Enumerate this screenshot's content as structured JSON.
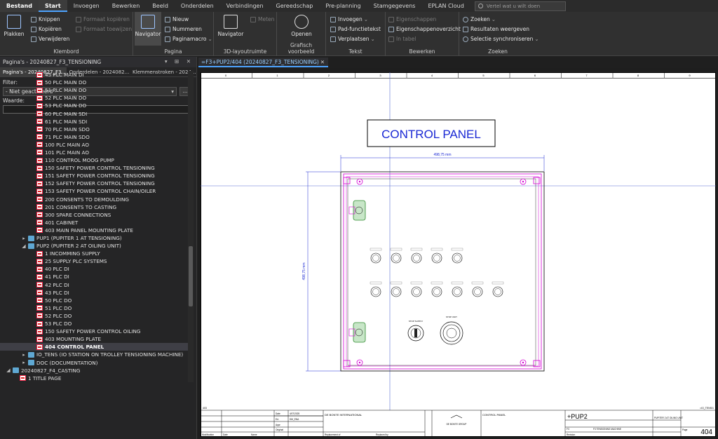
{
  "menubar": {
    "tabs": [
      "Bestand",
      "Start",
      "Invoegen",
      "Bewerken",
      "Beeld",
      "Onderdelen",
      "Verbindingen",
      "Gereedschap",
      "Pre-planning",
      "Stamgegevens",
      "EPLAN Cloud"
    ],
    "tellme_placeholder": "Vertel wat u wilt doen"
  },
  "ribbon": {
    "klembord": {
      "label": "Klembord",
      "paste": "Plakken",
      "cut": "Knippen",
      "copy": "Kopiëren",
      "delete": "Verwijderen",
      "copy_format": "Formaat kopiëren",
      "assign_format": "Formaat toewijzen"
    },
    "pagina": {
      "label": "Pagina",
      "navigator": "Navigator",
      "new": "Nieuw",
      "numbering": "Nummeren",
      "page_macro": "Paginamacro"
    },
    "layout3d": {
      "label": "3D-layoutruimte",
      "navigator": "Navigator",
      "measure": "Meten"
    },
    "graphic_preview": {
      "label": "Grafisch voorbeeld",
      "open": "Openen"
    },
    "tekst": {
      "label": "Tekst",
      "insert": "Invoegen",
      "path_text": "Pad-functietekst",
      "move": "Verplaatsen"
    },
    "bewerken": {
      "label": "Bewerken",
      "properties": "Eigenschappen",
      "properties_overview": "Eigenschappenoverzicht",
      "in_table": "In tabel"
    },
    "zoeken": {
      "label": "Zoeken",
      "search": "Zoeken",
      "show_results": "Resultaten weergeven",
      "sync_selection": "Selectie synchroniseren"
    }
  },
  "leftpanel": {
    "title": "Pagina's - 20240827_F3_TENSIONING",
    "tabs": [
      "Pagina's - 20240827_F3...",
      "Onderdelen - 2024082...",
      "Klemmenstroken - 2024..."
    ],
    "filter_label": "Filter:",
    "filter_value": "- Niet geactiveerd -",
    "value_label": "Waarde:",
    "tree": [
      {
        "text": "45 PLC MAIN DI",
        "type": "page"
      },
      {
        "text": "50 PLC MAIN DO",
        "type": "page"
      },
      {
        "text": "51 PLC MAIN DO",
        "type": "page"
      },
      {
        "text": "52 PLC MAIN DO",
        "type": "page"
      },
      {
        "text": "53 PLC MAIN DO",
        "type": "page"
      },
      {
        "text": "60 PLC MAIN SDI",
        "type": "page"
      },
      {
        "text": "61 PLC MAIN SDI",
        "type": "page"
      },
      {
        "text": "70 PLC MAIN SDO",
        "type": "page"
      },
      {
        "text": "71 PLC MAIN SDO",
        "type": "page"
      },
      {
        "text": "100 PLC MAIN AO",
        "type": "page"
      },
      {
        "text": "101 PLC MAIN AO",
        "type": "page"
      },
      {
        "text": "110 CONTROL MOOG PUMP",
        "type": "page"
      },
      {
        "text": "150 SAFETY POWER CONTROL TENSIONING",
        "type": "page"
      },
      {
        "text": "151 SAFETY POWER CONTROL TENSIONING",
        "type": "page"
      },
      {
        "text": "152 SAFETY POWER CONTROL TENSIONING",
        "type": "page"
      },
      {
        "text": "153 SAFETY POWER CONTROL  CHAIN/OILER",
        "type": "page"
      },
      {
        "text": "200 CONSENTS TO DEMOULDING",
        "type": "page"
      },
      {
        "text": "201 CONSENTS TO CASTING",
        "type": "page"
      },
      {
        "text": "300 SPARE CONNECTIONS",
        "type": "page"
      },
      {
        "text": "401 CABINET",
        "type": "page"
      },
      {
        "text": "403 MAIN PANEL MOUNTING PLATE",
        "type": "page"
      },
      {
        "text": "PUP1 (PUPITER 1 AT TENSIONING)",
        "type": "folder",
        "exp": "+"
      },
      {
        "text": "PUP2 (PUPITER 2 AT OILING UNIT)",
        "type": "folder",
        "exp": "-"
      },
      {
        "text": "1 INCOMMING SUPPLY",
        "type": "page"
      },
      {
        "text": "25 SUPPLY PLC SYSTEMS",
        "type": "page"
      },
      {
        "text": "40 PLC DI",
        "type": "page"
      },
      {
        "text": "41 PLC DI",
        "type": "page"
      },
      {
        "text": "42 PLC DI",
        "type": "page"
      },
      {
        "text": "43 PLC DI",
        "type": "page"
      },
      {
        "text": "50 PLC DO",
        "type": "page"
      },
      {
        "text": "51 PLC DO",
        "type": "page"
      },
      {
        "text": "52 PLC DO",
        "type": "page"
      },
      {
        "text": "53 PLC DO",
        "type": "page"
      },
      {
        "text": "150 SAFETY POWER CONTROL OILING",
        "type": "page"
      },
      {
        "text": "403 MOUNTING PLATE",
        "type": "page"
      },
      {
        "text": "404 CONTROL PANEL",
        "type": "page",
        "sel": true
      },
      {
        "text": "IO_TENS (IO STATION ON TROLLEY TENSIONING MACHINE)",
        "type": "folder",
        "exp": "+"
      },
      {
        "text": "DOC (DOCUMENTATION)",
        "type": "folder",
        "exp": "+"
      },
      {
        "text": "20240827_F4_CASTING",
        "type": "project",
        "exp": "-"
      },
      {
        "text": "1 TITLE PAGE",
        "type": "page"
      }
    ]
  },
  "document": {
    "tab_label": "=F3+PUP2/404 (20240827_F3_TENSIONING)",
    "drawing_title": "CONTROL PANEL",
    "width_dim": "498,75 mm",
    "height_dim": "498,75 mm",
    "stop_supply": "STOP SUPPLY",
    "stop_unit": "STOP UNIT",
    "company": "DE BONTE INTERNATIONAL",
    "logo_text": "DE BONTE GROUP",
    "title_block_desc": "CONTROL PANEL",
    "location": "+PUP2",
    "location_desc": "PUPITER 2 AT OILING UNIT",
    "function": "F3",
    "function_desc": "F3 TENSIONING MACHINE",
    "page_number": "404",
    "page_label": "Page",
    "sheet_ref_left": "403",
    "sheet_ref_right": "=IO_TENS/1",
    "date_label": "Date",
    "date_value": "4/07/2025",
    "ed_label": "Ed.",
    "ed_value": "DM_ENA",
    "appr_label": "Appr",
    "original_label": "Original",
    "modification_label": "Modification",
    "name_label": "Name",
    "replacement_label": "Replacement of",
    "replaced_label": "Replaced by",
    "revision_label": "Revision",
    "ruler_numbers": [
      "0",
      "1",
      "2",
      "3",
      "4",
      "5",
      "6",
      "7",
      "8",
      "9"
    ]
  }
}
